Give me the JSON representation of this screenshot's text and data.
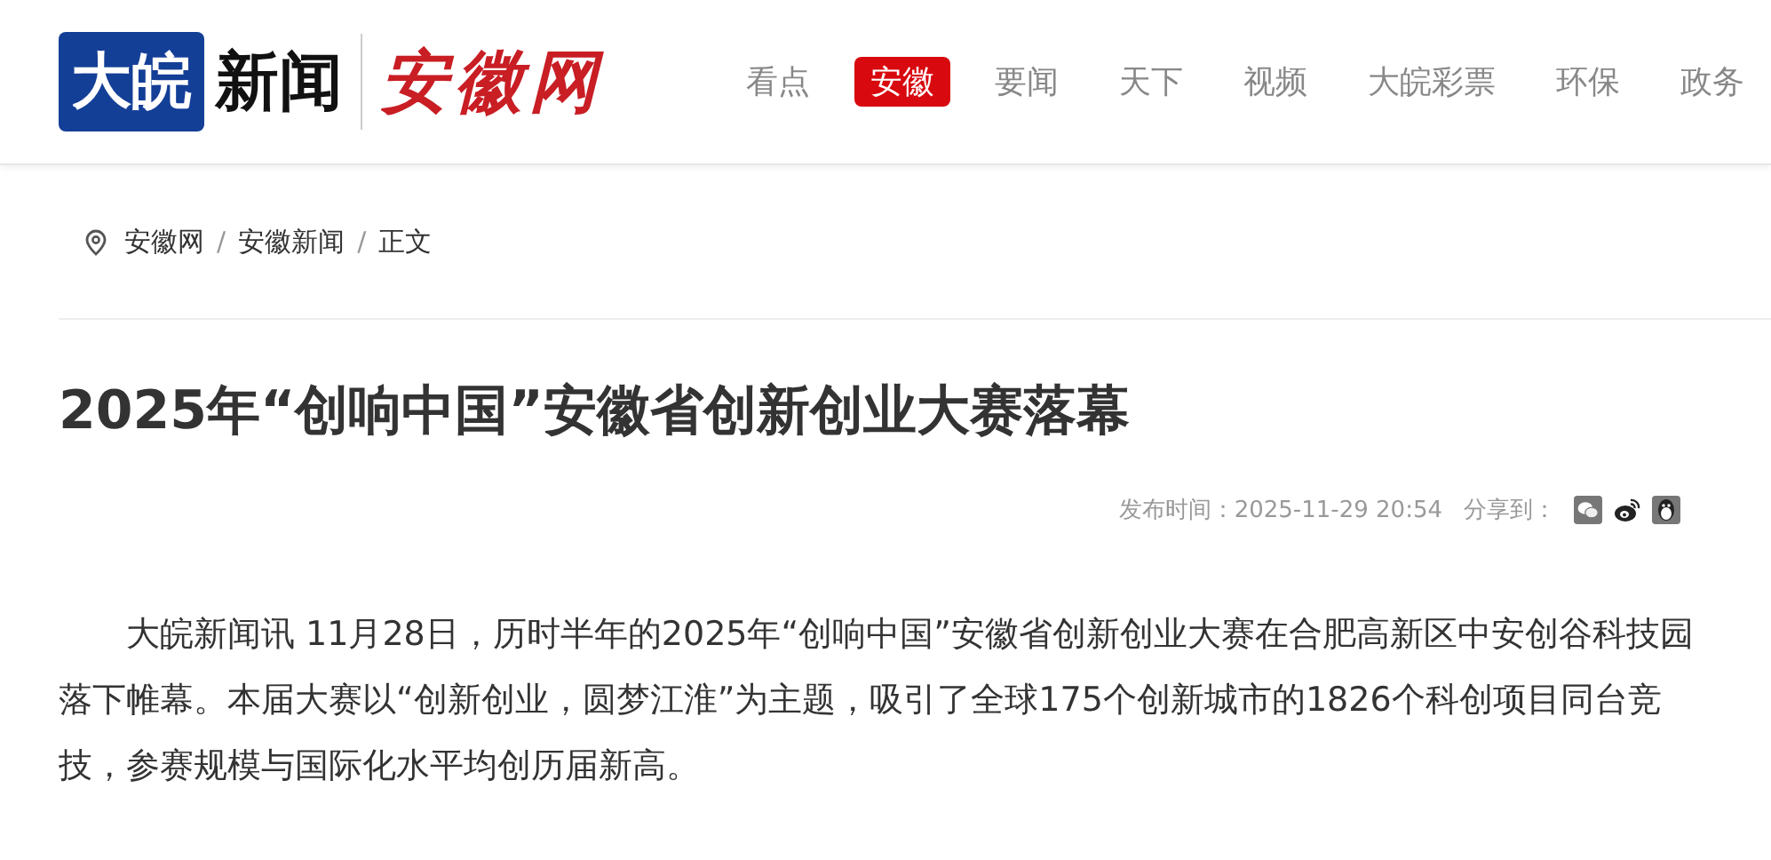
{
  "logo": {
    "brand_box": "大皖",
    "brand_text": "新闻",
    "site_name": "安徽网"
  },
  "nav": [
    {
      "label": "看点",
      "selected": false
    },
    {
      "label": "安徽",
      "selected": true
    },
    {
      "label": "要闻",
      "selected": false
    },
    {
      "label": "天下",
      "selected": false
    },
    {
      "label": "视频",
      "selected": false
    },
    {
      "label": "大皖彩票",
      "selected": false
    },
    {
      "label": "环保",
      "selected": false
    },
    {
      "label": "政务",
      "selected": false
    }
  ],
  "breadcrumb": [
    "安徽网",
    "安徽新闻",
    "正文"
  ],
  "breadcrumb_separator": "/",
  "title": "2025年“创响中国”安徽省创新创业大赛落幕",
  "meta": {
    "published_label": "发布时间：",
    "published": "2025-11-29 20:54",
    "share_label": "分享到：",
    "share": [
      {
        "kind": "wechat"
      },
      {
        "kind": "weibo"
      },
      {
        "kind": "qq"
      }
    ]
  },
  "body": [
    "大皖新闻讯 11月28日，历时半年的2025年“创响中国”安徽省创新创业大赛在合肥高新区中安创谷科技园落下帷幕。本届大赛以“创新创业，圆梦江淮”为主题，吸引了全球175个创新城市的1826个科创项目同台竞技，参赛规模与国际化水平均创历届新高。"
  ]
}
